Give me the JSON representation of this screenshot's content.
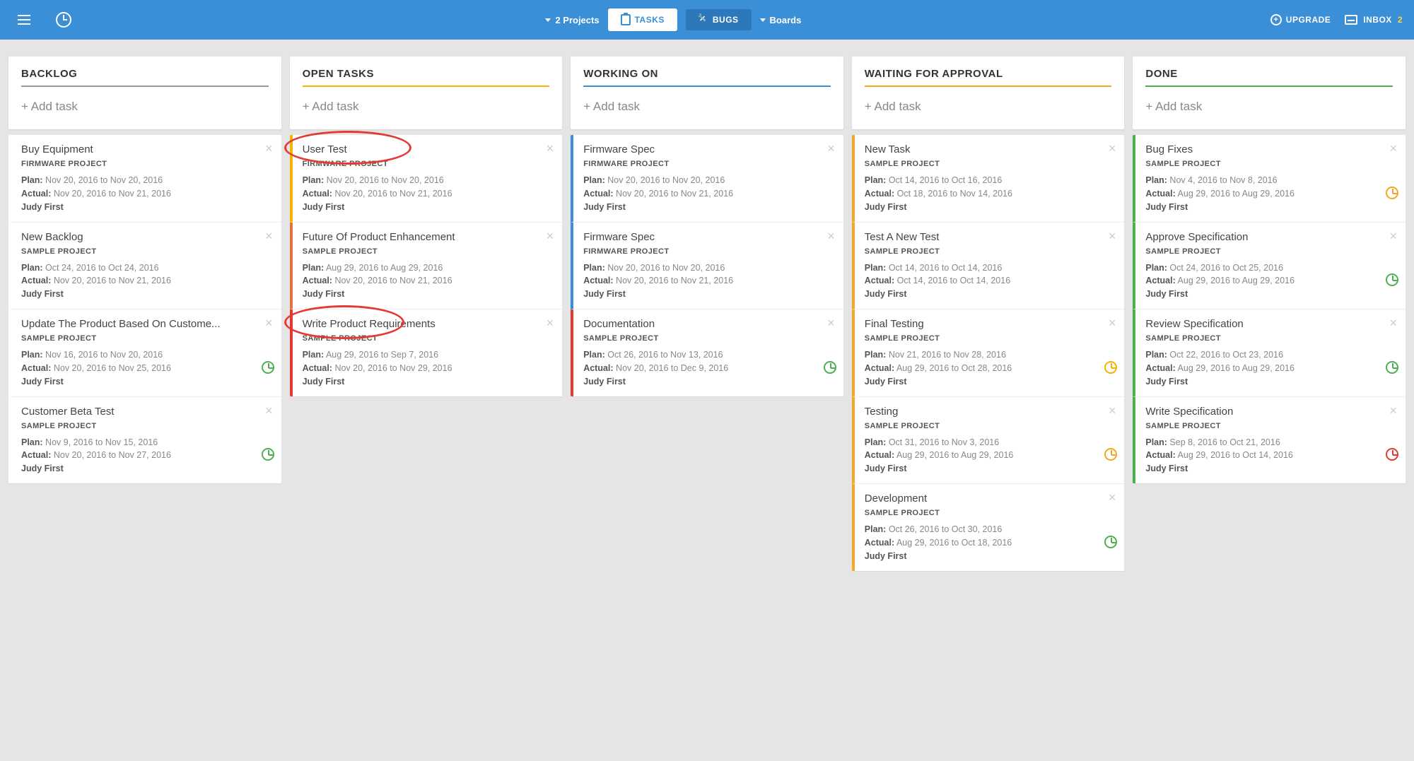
{
  "header": {
    "projects_label": "2 Projects",
    "tasks_tab": "TASKS",
    "bugs_tab": "BUGS",
    "boards_label": "Boards",
    "upgrade": "UPGRADE",
    "inbox_label": "INBOX",
    "inbox_count": "2"
  },
  "add_task_label": "+ Add task",
  "plan_label": "Plan:",
  "actual_label": "Actual:",
  "columns": [
    {
      "key": "backlog",
      "title": "BACKLOG",
      "cards": [
        {
          "title": "Buy Equipment",
          "project": "FIRMWARE PROJECT",
          "plan": "Nov 20, 2016 to Nov 20, 2016",
          "actual": "Nov 20, 2016 to Nov 21, 2016",
          "assignee": "Judy First"
        },
        {
          "title": "New Backlog",
          "project": "SAMPLE PROJECT",
          "plan": "Oct 24, 2016 to Oct 24, 2016",
          "actual": "Nov 20, 2016 to Nov 21, 2016",
          "assignee": "Judy First"
        },
        {
          "title": "Update The Product Based On Custome...",
          "project": "SAMPLE PROJECT",
          "plan": "Nov 16, 2016 to Nov 20, 2016",
          "actual": "Nov 20, 2016 to Nov 25, 2016",
          "assignee": "Judy First",
          "badge": "green"
        },
        {
          "title": "Customer Beta Test",
          "project": "SAMPLE PROJECT",
          "plan": "Nov 9, 2016 to Nov 15, 2016",
          "actual": "Nov 20, 2016 to Nov 27, 2016",
          "assignee": "Judy First",
          "badge": "green"
        }
      ]
    },
    {
      "key": "open-tasks",
      "title": "OPEN TASKS",
      "cards": [
        {
          "title": "User Test",
          "project": "FIRMWARE PROJECT",
          "plan": "Nov 20, 2016 to Nov 20, 2016",
          "actual": "Nov 20, 2016 to Nov 21, 2016",
          "assignee": "Judy First"
        },
        {
          "title": "Future Of Product Enhancement",
          "project": "SAMPLE PROJECT",
          "plan": "Aug 29, 2016 to Aug 29, 2016",
          "actual": "Nov 20, 2016 to Nov 21, 2016",
          "assignee": "Judy First"
        },
        {
          "title": "Write Product Requirements",
          "project": "SAMPLE PROJECT",
          "plan": "Aug 29, 2016 to Sep 7, 2016",
          "actual": "Nov 20, 2016 to Nov 29, 2016",
          "assignee": "Judy First"
        }
      ]
    },
    {
      "key": "working-on",
      "title": "WORKING ON",
      "cards": [
        {
          "title": "Firmware Spec",
          "project": "FIRMWARE PROJECT",
          "plan": "Nov 20, 2016 to Nov 20, 2016",
          "actual": "Nov 20, 2016 to Nov 21, 2016",
          "assignee": "Judy First"
        },
        {
          "title": "Firmware Spec",
          "project": "FIRMWARE PROJECT",
          "plan": "Nov 20, 2016 to Nov 20, 2016",
          "actual": "Nov 20, 2016 to Nov 21, 2016",
          "assignee": "Judy First"
        },
        {
          "title": "Documentation",
          "project": "SAMPLE PROJECT",
          "plan": "Oct 26, 2016 to Nov 13, 2016",
          "actual": "Nov 20, 2016 to Dec 9, 2016",
          "assignee": "Judy First",
          "badge": "green"
        }
      ]
    },
    {
      "key": "waiting",
      "title": "WAITING FOR APPROVAL",
      "cards": [
        {
          "title": "New Task",
          "project": "SAMPLE PROJECT",
          "plan": "Oct 14, 2016 to Oct 16, 2016",
          "actual": "Oct 18, 2016 to Nov 14, 2016",
          "assignee": "Judy First"
        },
        {
          "title": "Test A New Test",
          "project": "SAMPLE PROJECT",
          "plan": "Oct 14, 2016 to Oct 14, 2016",
          "actual": "Oct 14, 2016 to Oct 14, 2016",
          "assignee": "Judy First"
        },
        {
          "title": "Final Testing",
          "project": "SAMPLE PROJECT",
          "plan": "Nov 21, 2016 to Nov 28, 2016",
          "actual": "Aug 29, 2016 to Oct 28, 2016",
          "assignee": "Judy First",
          "badge": "yellow"
        },
        {
          "title": "Testing",
          "project": "SAMPLE PROJECT",
          "plan": "Oct 31, 2016 to Nov 3, 2016",
          "actual": "Aug 29, 2016 to Aug 29, 2016",
          "assignee": "Judy First",
          "badge": "orange"
        },
        {
          "title": "Development",
          "project": "SAMPLE PROJECT",
          "plan": "Oct 26, 2016 to Oct 30, 2016",
          "actual": "Aug 29, 2016 to Oct 18, 2016",
          "assignee": "Judy First",
          "badge": "green"
        }
      ]
    },
    {
      "key": "done",
      "title": "DONE",
      "cards": [
        {
          "title": "Bug Fixes",
          "project": "SAMPLE PROJECT",
          "plan": "Nov 4, 2016 to Nov 8, 2016",
          "actual": "Aug 29, 2016 to Aug 29, 2016",
          "assignee": "Judy First",
          "badge": "orange"
        },
        {
          "title": "Approve Specification",
          "project": "SAMPLE PROJECT",
          "plan": "Oct 24, 2016 to Oct 25, 2016",
          "actual": "Aug 29, 2016 to Aug 29, 2016",
          "assignee": "Judy First",
          "badge": "green"
        },
        {
          "title": "Review Specification",
          "project": "SAMPLE PROJECT",
          "plan": "Oct 22, 2016 to Oct 23, 2016",
          "actual": "Aug 29, 2016 to Aug 29, 2016",
          "assignee": "Judy First",
          "badge": "green"
        },
        {
          "title": "Write Specification",
          "project": "SAMPLE PROJECT",
          "plan": "Sep 8, 2016 to Oct 21, 2016",
          "actual": "Aug 29, 2016 to Oct 14, 2016",
          "assignee": "Judy First",
          "badge": "red"
        }
      ]
    }
  ]
}
